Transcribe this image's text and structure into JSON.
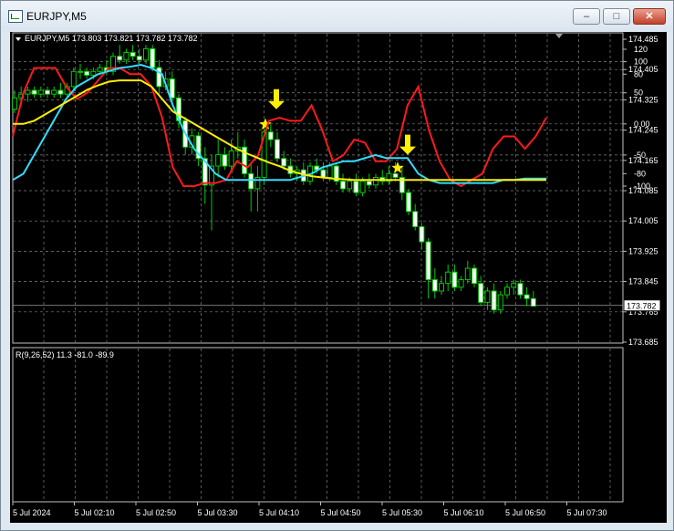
{
  "window": {
    "title": "EURJPY,M5",
    "buttons": {
      "minimize": "–",
      "maximize": "□",
      "close": "✕"
    }
  },
  "main_chart": {
    "info": "EURJPY,M5  173.803 173.821 173.782 173.782",
    "current_price": "173.782",
    "y_ticks": [
      "174.485",
      "174.405",
      "174.325",
      "174.245",
      "174.165",
      "174.085",
      "174.005",
      "173.925",
      "173.845",
      "173.765",
      "173.685"
    ],
    "candle_colors": {
      "bull": "#00cc00",
      "bear": "#ffffff",
      "wick": "#00cc00"
    },
    "markers": [
      {
        "type": "star",
        "color": "#ffee00",
        "icon": "star-icon",
        "price": 174.26
      },
      {
        "type": "arrow-down",
        "color": "#ffee00",
        "icon": "arrow-down-icon",
        "price": 174.3
      },
      {
        "type": "star",
        "color": "#ffee00",
        "icon": "star-icon",
        "price": 174.145
      },
      {
        "type": "arrow-down",
        "color": "#ffee00",
        "icon": "arrow-down-icon",
        "price": 174.18
      }
    ]
  },
  "indicator": {
    "label": "R(9,26,52) 11.3 -81.0 -89.9",
    "y_ticks": [
      "120",
      "100",
      "80",
      "50",
      "0.00",
      "-50",
      "-80",
      "-100"
    ],
    "line_colors": {
      "fast": "#ff1a1a",
      "medium": "#33ddff",
      "slow": "#ffee00"
    }
  },
  "x_axis": {
    "labels": [
      "5 Jul 2024",
      "5 Jul 02:10",
      "5 Jul 02:50",
      "5 Jul 03:30",
      "5 Jul 04:10",
      "5 Jul 04:50",
      "5 Jul 05:30",
      "5 Jul 06:10",
      "5 Jul 06:50",
      "5 Jul 07:30"
    ]
  },
  "chart_data": [
    {
      "type": "candlestick",
      "title": "EURJPY,M5",
      "ylim": [
        173.685,
        174.485
      ],
      "grid": true,
      "candles_ohlc": [
        [
          174.3,
          174.35,
          174.29,
          174.33
        ],
        [
          174.33,
          174.36,
          174.31,
          174.34
        ],
        [
          174.34,
          174.36,
          174.32,
          174.35
        ],
        [
          174.35,
          174.36,
          174.33,
          174.34
        ],
        [
          174.34,
          174.36,
          174.33,
          174.35
        ],
        [
          174.35,
          174.36,
          174.33,
          174.34
        ],
        [
          174.34,
          174.36,
          174.33,
          174.35
        ],
        [
          174.35,
          174.37,
          174.33,
          174.34
        ],
        [
          174.34,
          174.37,
          174.33,
          174.36
        ],
        [
          174.36,
          174.41,
          174.35,
          174.4
        ],
        [
          174.4,
          174.42,
          174.38,
          174.4
        ],
        [
          174.4,
          174.41,
          174.38,
          174.39
        ],
        [
          174.39,
          174.41,
          174.38,
          174.4
        ],
        [
          174.4,
          174.42,
          174.39,
          174.41
        ],
        [
          174.41,
          174.43,
          174.39,
          174.4
        ],
        [
          174.4,
          174.45,
          174.39,
          174.44
        ],
        [
          174.44,
          174.47,
          174.42,
          174.43
        ],
        [
          174.43,
          174.46,
          174.42,
          174.45
        ],
        [
          174.45,
          174.47,
          174.43,
          174.44
        ],
        [
          174.44,
          174.46,
          174.42,
          174.43
        ],
        [
          174.43,
          174.47,
          174.42,
          174.46
        ],
        [
          174.46,
          174.47,
          174.4,
          174.41
        ],
        [
          174.41,
          174.43,
          174.34,
          174.36
        ],
        [
          174.36,
          174.4,
          174.35,
          174.38
        ],
        [
          174.38,
          174.4,
          174.32,
          174.33
        ],
        [
          174.33,
          174.34,
          174.25,
          174.27
        ],
        [
          174.27,
          174.28,
          174.18,
          174.2
        ],
        [
          174.2,
          174.25,
          174.18,
          174.23
        ],
        [
          174.23,
          174.24,
          174.15,
          174.17
        ],
        [
          174.17,
          174.2,
          174.05,
          174.1
        ],
        [
          174.1,
          174.18,
          173.98,
          174.15
        ],
        [
          174.15,
          174.22,
          174.12,
          174.18
        ],
        [
          174.18,
          174.2,
          174.14,
          174.15
        ],
        [
          174.15,
          174.22,
          174.14,
          174.19
        ],
        [
          174.19,
          174.24,
          174.17,
          174.2
        ],
        [
          174.2,
          174.22,
          174.12,
          174.13
        ],
        [
          174.13,
          174.16,
          174.03,
          174.09
        ],
        [
          174.09,
          174.15,
          174.03,
          174.12
        ],
        [
          174.12,
          174.25,
          174.1,
          174.24
        ],
        [
          174.24,
          174.26,
          174.2,
          174.22
        ],
        [
          174.22,
          174.24,
          174.16,
          174.17
        ],
        [
          174.17,
          174.19,
          174.14,
          174.15
        ],
        [
          174.15,
          174.17,
          174.12,
          174.13
        ],
        [
          174.13,
          174.15,
          174.11,
          174.14
        ],
        [
          174.14,
          174.16,
          174.1,
          174.11
        ],
        [
          174.11,
          174.16,
          174.1,
          174.15
        ],
        [
          174.15,
          174.17,
          174.13,
          174.14
        ],
        [
          174.14,
          174.16,
          174.11,
          174.12
        ],
        [
          174.12,
          174.16,
          174.11,
          174.15
        ],
        [
          174.15,
          174.16,
          174.1,
          174.11
        ],
        [
          174.11,
          174.13,
          174.08,
          174.09
        ],
        [
          174.09,
          174.12,
          174.08,
          174.11
        ],
        [
          174.11,
          174.13,
          174.07,
          174.08
        ],
        [
          174.08,
          174.12,
          174.07,
          174.11
        ],
        [
          174.11,
          174.13,
          174.09,
          174.1
        ],
        [
          174.1,
          174.13,
          174.09,
          174.12
        ],
        [
          174.12,
          174.14,
          174.1,
          174.11
        ],
        [
          174.11,
          174.15,
          174.1,
          174.13
        ],
        [
          174.13,
          174.16,
          174.11,
          174.12
        ],
        [
          174.12,
          174.15,
          174.06,
          174.08
        ],
        [
          174.08,
          174.09,
          174.02,
          174.03
        ],
        [
          174.03,
          174.05,
          173.98,
          173.99
        ],
        [
          173.99,
          174.0,
          173.93,
          173.95
        ],
        [
          173.95,
          173.96,
          173.8,
          173.85
        ],
        [
          173.85,
          173.88,
          173.8,
          173.82
        ],
        [
          173.82,
          173.86,
          173.81,
          173.84
        ],
        [
          173.84,
          173.89,
          173.82,
          173.87
        ],
        [
          173.87,
          173.89,
          173.82,
          173.83
        ],
        [
          173.83,
          173.86,
          173.82,
          173.85
        ],
        [
          173.85,
          173.9,
          173.84,
          173.88
        ],
        [
          173.88,
          173.89,
          173.83,
          173.84
        ],
        [
          173.84,
          173.86,
          173.78,
          173.79
        ],
        [
          173.79,
          173.83,
          173.77,
          173.82
        ],
        [
          173.82,
          173.84,
          173.76,
          173.77
        ],
        [
          173.77,
          173.82,
          173.76,
          173.81
        ],
        [
          173.81,
          173.84,
          173.8,
          173.83
        ],
        [
          173.83,
          173.85,
          173.81,
          173.84
        ],
        [
          173.84,
          173.85,
          173.8,
          173.81
        ],
        [
          173.81,
          173.83,
          173.78,
          173.8
        ],
        [
          173.8,
          173.82,
          173.78,
          173.78
        ]
      ]
    },
    {
      "type": "line",
      "title": "R(9,26,52)",
      "ylim": [
        -100,
        120
      ],
      "series": [
        {
          "name": "11.3",
          "color": "#ff1a1a",
          "values": [
            -20,
            50,
            90,
            90,
            90,
            60,
            40,
            50,
            70,
            90,
            90,
            80,
            80,
            60,
            10,
            -70,
            -100,
            -100,
            -95,
            -95,
            -90,
            -60,
            -70,
            -50,
            5,
            10,
            5,
            5,
            30,
            -10,
            -60,
            -50,
            -25,
            -30,
            -60,
            -60,
            -40,
            30,
            60,
            -10,
            -60,
            -90,
            -100,
            -90,
            -80,
            -40,
            -20,
            -20,
            -40,
            -20,
            10
          ]
        },
        {
          "name": "-81.0",
          "color": "#33ddff",
          "values": [
            -90,
            -80,
            -50,
            -20,
            10,
            40,
            60,
            70,
            80,
            85,
            90,
            92,
            95,
            90,
            80,
            30,
            -10,
            -40,
            -60,
            -80,
            -90,
            -90,
            -90,
            -90,
            -90,
            -90,
            -90,
            -85,
            -80,
            -70,
            -65,
            -60,
            -60,
            -55,
            -50,
            -55,
            -55,
            -55,
            -80,
            -90,
            -95,
            -95,
            -95,
            -95,
            -95,
            -95,
            -90,
            -90,
            -88,
            -88,
            -88
          ]
        },
        {
          "name": "-89.9",
          "color": "#ffee00",
          "values": [
            0,
            0,
            5,
            15,
            25,
            35,
            45,
            55,
            62,
            68,
            70,
            70,
            70,
            60,
            40,
            20,
            10,
            0,
            -10,
            -20,
            -30,
            -40,
            -48,
            -55,
            -62,
            -68,
            -75,
            -80,
            -84,
            -86,
            -88,
            -89,
            -90,
            -90,
            -90,
            -90,
            -90,
            -90,
            -90,
            -90,
            -90,
            -90,
            -90,
            -90,
            -90,
            -90,
            -90,
            -90,
            -90,
            -90,
            -90
          ]
        }
      ]
    }
  ]
}
